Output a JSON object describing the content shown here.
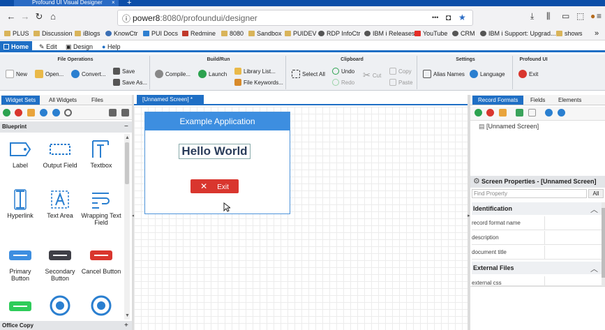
{
  "browser": {
    "tab_title": "Profound UI Visual Designer",
    "tab_close": "×",
    "new_tab": "+",
    "url_host": "power8",
    "url_path": ":8080/profoundui/designer",
    "more": "•••",
    "bookmarks": [
      "PLUS",
      "Discussion",
      "iBlogs",
      "KnowCtr",
      "PUI Docs",
      "Redmine",
      "8080",
      "Sandbox",
      "PUIDEV",
      "RDP InfoCtr",
      "IBM i Releases",
      "YouTube",
      "CRM",
      "IBM i Support: Upgrad..."
    ],
    "bookmarks_more": "shows"
  },
  "menu": {
    "home": "Home",
    "edit": "Edit",
    "design": "Design",
    "help": "Help"
  },
  "ribbon": {
    "file_ops": {
      "title": "File Operations",
      "new": "New",
      "open": "Open...",
      "convert": "Convert...",
      "save": "Save",
      "save_as": "Save As..."
    },
    "build": {
      "title": "Build/Run",
      "compile": "Compile...",
      "launch": "Launch",
      "library_list": "Library List...",
      "file_keywords": "File Keywords..."
    },
    "clipboard": {
      "title": "Clipboard",
      "select_all": "Select All",
      "undo": "Undo",
      "redo": "Redo",
      "cut": "Cut",
      "copy": "Copy",
      "paste": "Paste"
    },
    "settings": {
      "title": "Settings",
      "alias_names": "Alias Names",
      "language": "Language"
    },
    "profound": {
      "title": "Profound UI",
      "exit": "Exit"
    }
  },
  "left_panel": {
    "tabs": [
      "Widget Sets",
      "All Widgets",
      "Files"
    ],
    "section": "Blueprint",
    "widgets": [
      {
        "label": "Label"
      },
      {
        "label": "Output Field"
      },
      {
        "label": "Textbox"
      },
      {
        "label": "Hyperlink"
      },
      {
        "label": "Text Area"
      },
      {
        "label": "Wrapping Text Field"
      },
      {
        "label": "Primary Button"
      },
      {
        "label": "Secondary Button"
      },
      {
        "label": "Cancel Button"
      }
    ],
    "section2": "Office Copy",
    "collapse": "−",
    "expand": "+"
  },
  "canvas": {
    "tab": "[Unnamed Screen] *",
    "app_title": "Example Application",
    "hello": "Hello World",
    "exit": "Exit"
  },
  "right_panel": {
    "tabs": [
      "Record Formats",
      "Fields",
      "Elements"
    ],
    "tree_item": "[Unnamed Screen]",
    "props_title": "Screen Properties - [Unnamed Screen]",
    "find_placeholder": "Find Property",
    "find_all": "All",
    "sections": [
      {
        "title": "Identification",
        "rows": [
          "record format name",
          "description",
          "document title"
        ]
      },
      {
        "title": "External Files",
        "rows": [
          "external css"
        ]
      }
    ]
  },
  "colors": {
    "accent": "#1f6fc5",
    "header": "#3d8ee0",
    "exit": "#d9362e"
  }
}
